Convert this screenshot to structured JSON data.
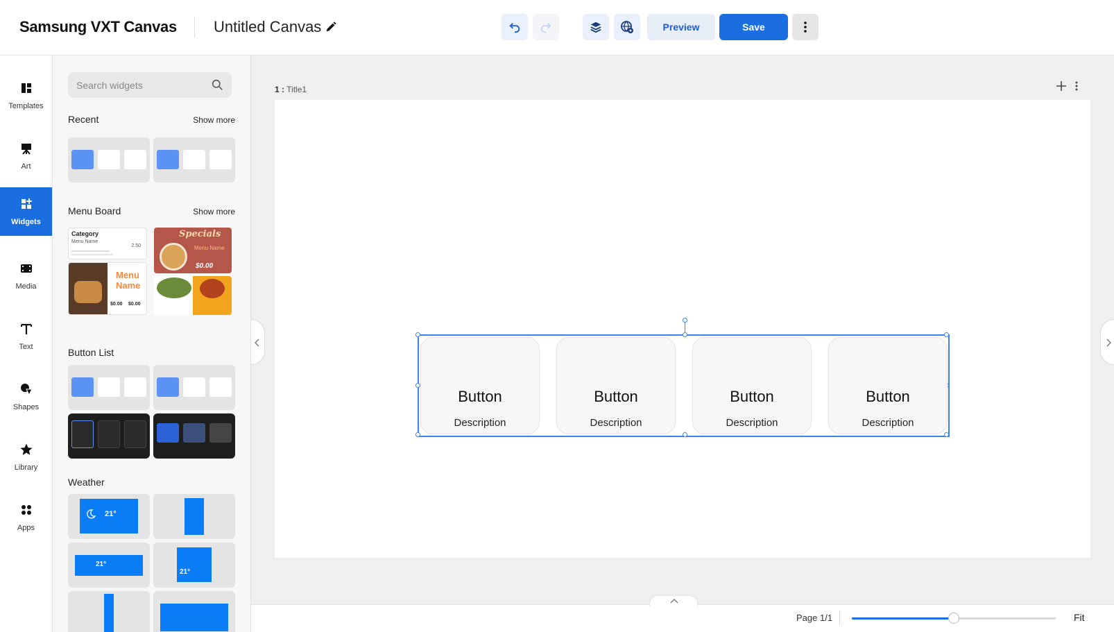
{
  "header": {
    "brand": "Samsung VXT Canvas",
    "doc_title": "Untitled Canvas",
    "preview_label": "Preview",
    "save_label": "Save"
  },
  "rail": {
    "items": [
      {
        "label": "Templates",
        "icon": "templates-icon"
      },
      {
        "label": "Art",
        "icon": "easel-icon"
      },
      {
        "label": "Widgets",
        "icon": "widgets-icon",
        "active": true
      },
      {
        "label": "Media",
        "icon": "film-icon"
      },
      {
        "label": "Text",
        "icon": "text-icon"
      },
      {
        "label": "Shapes",
        "icon": "shapes-icon"
      },
      {
        "label": "Library",
        "icon": "star-icon"
      },
      {
        "label": "Apps",
        "icon": "apps-icon"
      }
    ]
  },
  "panel": {
    "search_placeholder": "Search widgets",
    "sections": {
      "recent": "Recent",
      "menu_board": "Menu Board",
      "button_list": "Button List",
      "weather": "Weather"
    },
    "show_more": "Show more",
    "menu_thumbs": {
      "category": "Category",
      "menu_name": "Menu Name",
      "price": "2.50",
      "specials": "Specials",
      "specials_price": "$0.00",
      "menu": "Menu",
      "name": "Name",
      "pancake_price_a": "$0.00",
      "pancake_price_b": "$0.00"
    },
    "weather_temp": "21°"
  },
  "canvas": {
    "page_number": "1 :",
    "page_title": "Title1",
    "buttons": [
      {
        "title": "Button",
        "description": "Description"
      },
      {
        "title": "Button",
        "description": "Description"
      },
      {
        "title": "Button",
        "description": "Description"
      },
      {
        "title": "Button",
        "description": "Description"
      }
    ]
  },
  "footer": {
    "page_count": "Page 1/1",
    "fit_label": "Fit",
    "zoom_fraction": 0.5
  },
  "colors": {
    "accent": "#1a6ee0",
    "selection": "#3a84ea",
    "weather_blue": "#0a7cf5"
  }
}
